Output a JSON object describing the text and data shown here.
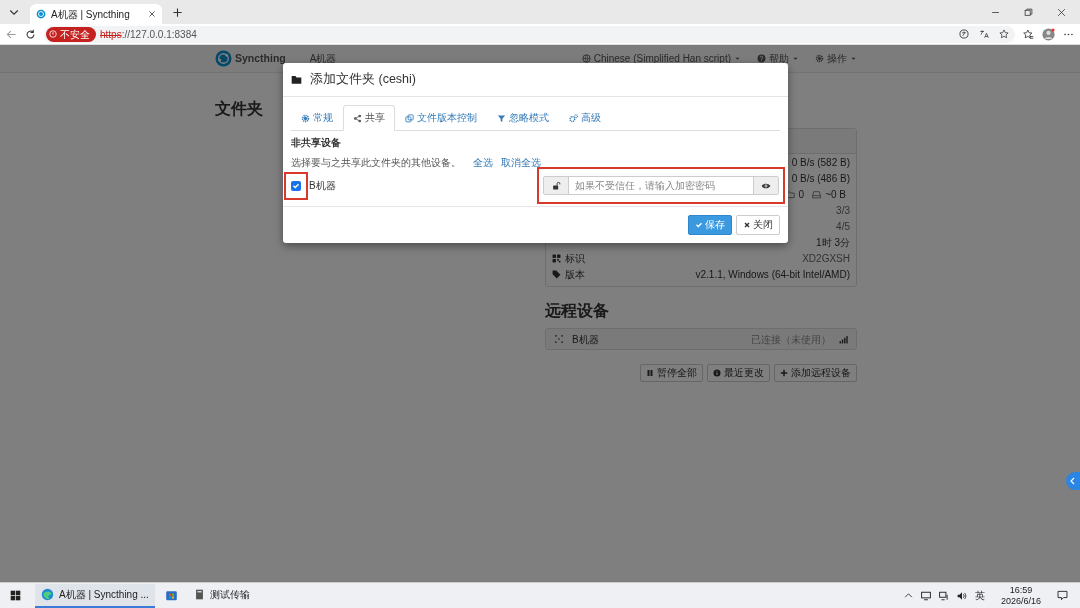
{
  "browser": {
    "tab_title": "A机器 | Syncthing",
    "security_badge": "不安全",
    "url_scheme": "https",
    "url_rest": "://127.0.0.1:8384"
  },
  "navbar": {
    "brand": "Syncthing",
    "device_name": "A机器",
    "menus": [
      {
        "kind": "language",
        "label": "Chinese (Simplified Han script)"
      },
      {
        "kind": "help",
        "label": "帮助"
      },
      {
        "kind": "actions",
        "label": "操作"
      }
    ]
  },
  "folders": {
    "heading": "文件夹"
  },
  "this_device": {
    "rows": [
      {
        "kind": "value",
        "value": "0 B/s (582 B)",
        "muted": false
      },
      {
        "kind": "value",
        "value": "0 B/s (486 B)",
        "muted": false
      },
      {
        "kind": "counts",
        "parts": [
          "0",
          "~0 B"
        ]
      },
      {
        "kind": "value",
        "value": "3/3",
        "muted": true
      },
      {
        "kind": "value",
        "value": "4/5",
        "muted": true
      },
      {
        "kind": "value",
        "value": "1时 3分",
        "muted": false
      },
      {
        "kind": "identity",
        "label": "标识",
        "value": "XD2GXSH",
        "muted": true
      },
      {
        "kind": "version",
        "label": "版本",
        "value": "v2.1.1, Windows (64-bit Intel/AMD)",
        "muted": false
      }
    ]
  },
  "remote": {
    "heading": "远程设备",
    "devices": [
      {
        "name": "B机器",
        "status": "已连接（未使用）"
      }
    ],
    "buttons": [
      {
        "kind": "pause",
        "label": "暂停全部"
      },
      {
        "kind": "recent",
        "label": "最近更改"
      },
      {
        "kind": "add",
        "label": "添加远程设备"
      }
    ]
  },
  "modal": {
    "title": "添加文件夹 (ceshi)",
    "tabs": [
      {
        "kind": "general",
        "label": "常规",
        "selected": false
      },
      {
        "kind": "sharing",
        "label": "共享",
        "selected": true
      },
      {
        "kind": "versioning",
        "label": "文件版本控制",
        "selected": false
      },
      {
        "kind": "ignore",
        "label": "忽略模式",
        "selected": false
      },
      {
        "kind": "advanced",
        "label": "高级",
        "selected": false
      }
    ],
    "section_title": "非共享设备",
    "hint": "选择要与之共享此文件夹的其他设备。",
    "links": [
      "全选",
      "取消全选"
    ],
    "devices": [
      {
        "name": "B机器",
        "checked": true,
        "checkbox_highlighted": true,
        "password_placeholder": "如果不受信任，请输入加密密码",
        "password_highlighted": true
      }
    ],
    "buttons": [
      {
        "kind": "primary",
        "label": "保存"
      },
      {
        "kind": "default",
        "label": "关闭"
      }
    ]
  },
  "taskbar": {
    "items": [
      {
        "kind": "browser",
        "label": "A机器 | Syncthing ...",
        "active": true
      },
      {
        "kind": "store",
        "active": false
      },
      {
        "kind": "app",
        "label": "测试传输",
        "active": false
      }
    ],
    "ime": "英",
    "time": "16:59",
    "date": "2026/6/16"
  }
}
